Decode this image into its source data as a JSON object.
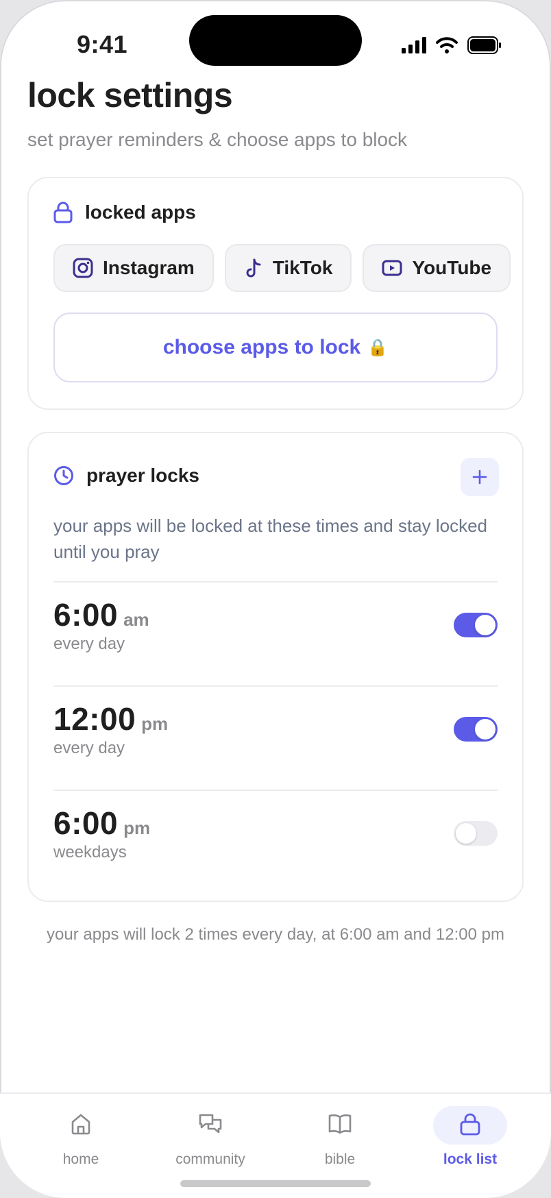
{
  "status_bar": {
    "time": "9:41"
  },
  "header": {
    "title": "lock settings",
    "subtitle": "set prayer reminders & choose apps to block"
  },
  "locked_apps": {
    "title": "locked apps",
    "apps": [
      {
        "label": "Instagram",
        "icon": "instagram-icon"
      },
      {
        "label": "TikTok",
        "icon": "tiktok-icon"
      },
      {
        "label": "YouTube",
        "icon": "youtube-icon"
      }
    ],
    "choose_label": "choose apps to lock",
    "choose_emoji": "🔒"
  },
  "prayer_locks": {
    "title": "prayer locks",
    "description": "your apps will be locked at these times and stay locked until you pray",
    "items": [
      {
        "time": "6:00",
        "period": "am",
        "frequency": "every day",
        "enabled": true
      },
      {
        "time": "12:00",
        "period": "pm",
        "frequency": "every day",
        "enabled": true
      },
      {
        "time": "6:00",
        "period": "pm",
        "frequency": "weekdays",
        "enabled": false
      }
    ]
  },
  "summary": "your apps will lock 2 times every day, at 6:00 am and 12:00 pm",
  "tabbar": {
    "items": [
      {
        "label": "home",
        "icon": "home-icon"
      },
      {
        "label": "community",
        "icon": "chat-bubbles-icon"
      },
      {
        "label": "bible",
        "icon": "book-icon"
      },
      {
        "label": "lock list",
        "icon": "lock-icon",
        "active": true
      }
    ]
  },
  "colors": {
    "accent": "#5b5be8",
    "accent_soft": "#eef0fe",
    "muted": "#8a8a8e"
  }
}
